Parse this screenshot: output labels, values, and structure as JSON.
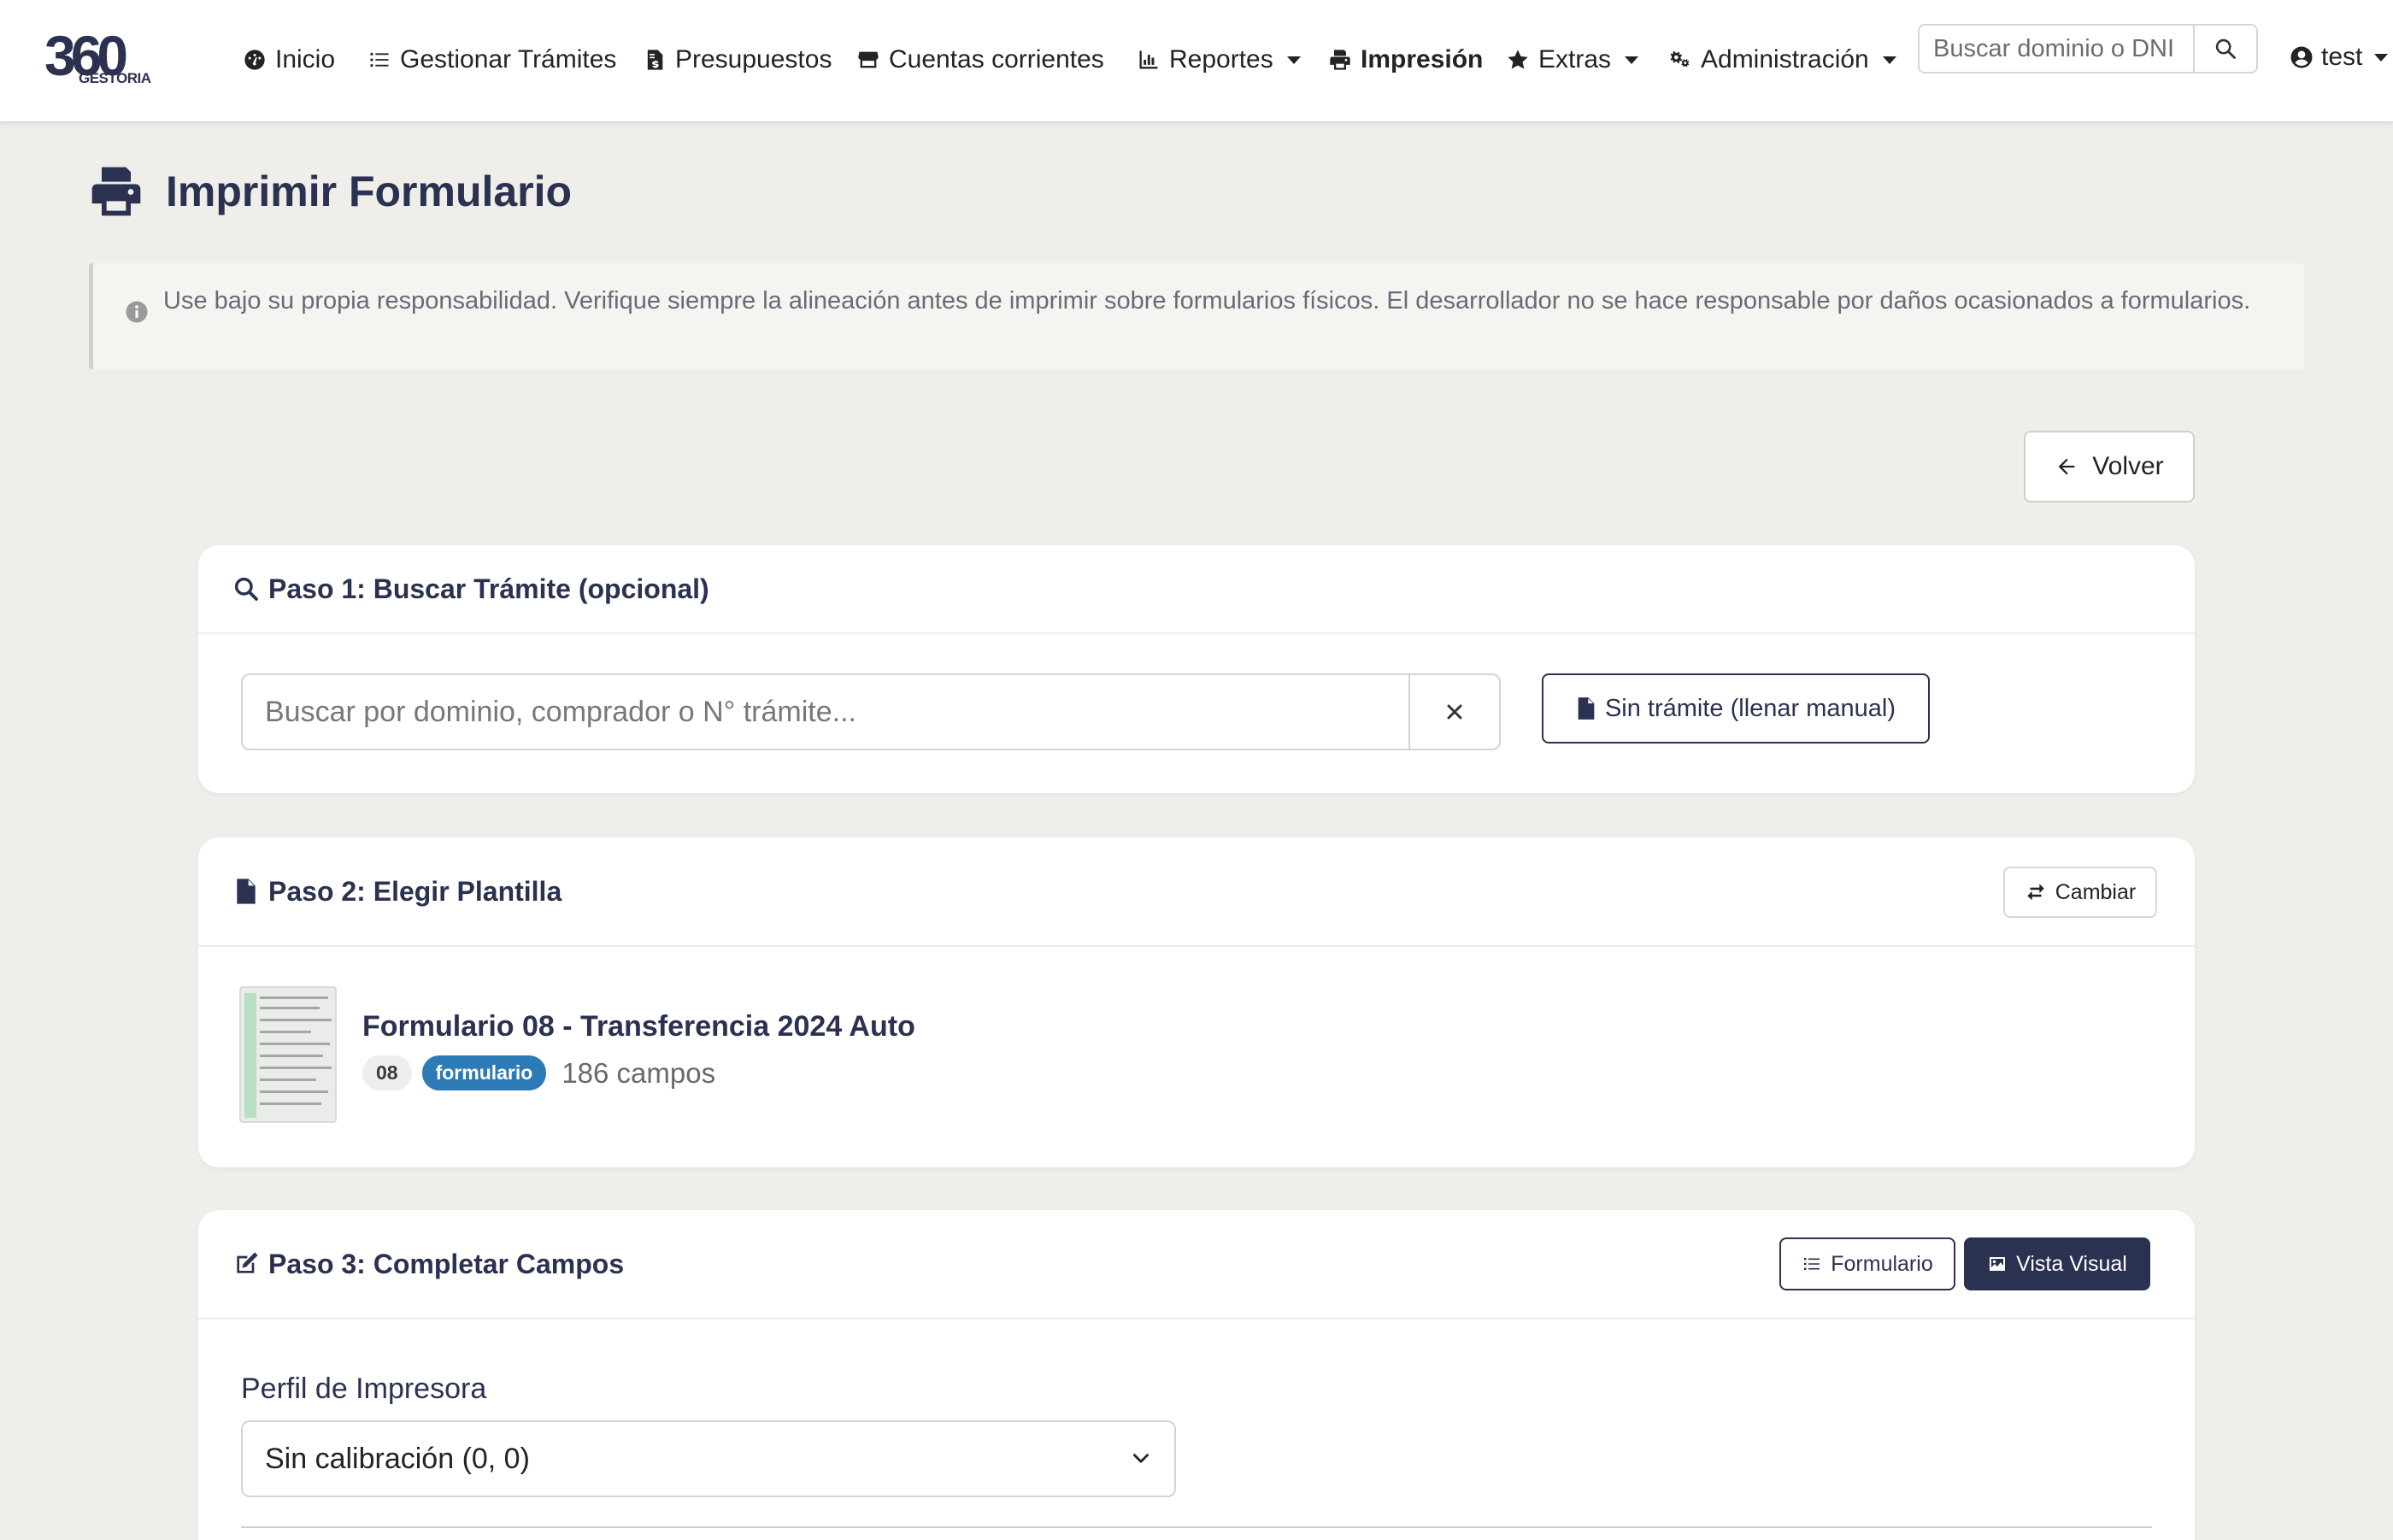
{
  "brand": {
    "logo_number": "360",
    "logo_sub": "GESTORIA"
  },
  "nav": {
    "items": [
      {
        "label": "Inicio",
        "icon": "dashboard-icon"
      },
      {
        "label": "Gestionar Trámites",
        "icon": "list-icon"
      },
      {
        "label": "Presupuestos",
        "icon": "invoice-icon"
      },
      {
        "label": "Cuentas corrientes",
        "icon": "store-icon"
      },
      {
        "label": "Reportes",
        "icon": "chart-icon",
        "dropdown": true
      },
      {
        "label": "Impresión",
        "icon": "printer-icon",
        "active": true
      },
      {
        "label": "Extras",
        "icon": "star-icon",
        "dropdown": true
      },
      {
        "label": "Administración",
        "icon": "gears-icon",
        "dropdown": true
      }
    ],
    "search_placeholder": "Buscar dominio o DNI",
    "user": "test"
  },
  "page": {
    "title": "Imprimir Formulario",
    "alert": "Use bajo su propia responsabilidad. Verifique siempre la alineación antes de imprimir sobre formularios físicos. El desarrollador no se hace responsable por daños ocasionados a formularios.",
    "back_label": "Volver"
  },
  "step1": {
    "title": "Paso 1: Buscar Trámite (opcional)",
    "search_placeholder": "Buscar por dominio, comprador o N° trámite...",
    "manual_label": "Sin trámite (llenar manual)"
  },
  "step2": {
    "title": "Paso 2: Elegir Plantilla",
    "change_label": "Cambiar",
    "template": {
      "name": "Formulario 08 - Transferencia 2024 Auto",
      "code": "08",
      "type": "formulario",
      "fields": "186 campos"
    }
  },
  "step3": {
    "title": "Paso 3: Completar Campos",
    "form_view_label": "Formulario",
    "visual_view_label": "Vista Visual",
    "printer_profile_label": "Perfil de Impresora",
    "printer_profile_value": "Sin calibración (0, 0)"
  },
  "colors": {
    "primary": "#2b3150",
    "badge_blue": "#2c7bb6",
    "background": "#efeeea"
  }
}
